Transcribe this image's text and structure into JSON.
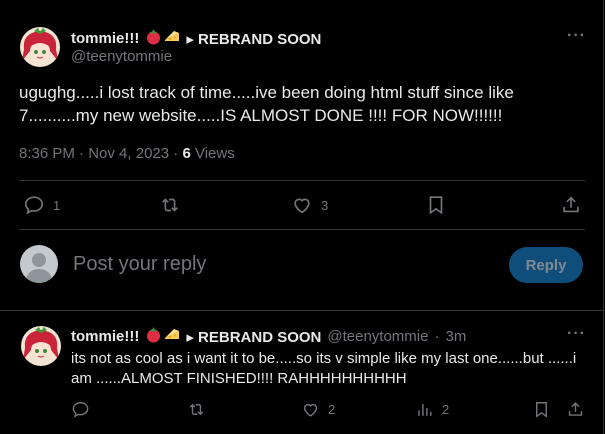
{
  "main_tweet": {
    "display_name": "tommie!!!",
    "badge": "▸ REBRAND SOON",
    "handle": "@teenytommie",
    "text": "ugughg.....i lost track of time.....ive been doing html stuff since like 7..........my new website.....IS ALMOST DONE !!!! FOR NOW!!!!!!",
    "time": "8:36 PM",
    "separator": "·",
    "date": "Nov 4, 2023",
    "views_count": "6",
    "views_label": "Views",
    "replies": "1",
    "likes": "3",
    "more": "···"
  },
  "composer": {
    "placeholder": "Post your reply",
    "button_label": "Reply"
  },
  "reply_tweet": {
    "display_name": "tommie!!!",
    "badge": "▸ REBRAND SOON",
    "handle": "@teenytommie",
    "separator": "·",
    "age": "3m",
    "text": "its not as cool as i want it to be.....so its v simple like my last one......but ......i am ......ALMOST FINISHED!!!! RAHHHHHHHHHH",
    "likes": "2",
    "views": "2",
    "more": "···"
  },
  "colors": {
    "background": "#000000",
    "text": "#e7e9ea",
    "muted": "#71767b",
    "border": "#2f3336",
    "reply_button": "#0f4e7a"
  },
  "icons": [
    "tomato-emoji-icon",
    "cheese-emoji-icon",
    "reply-icon",
    "retweet-icon",
    "like-icon",
    "views-icon",
    "bookmark-icon",
    "share-icon",
    "more-icon",
    "default-avatar-icon"
  ]
}
